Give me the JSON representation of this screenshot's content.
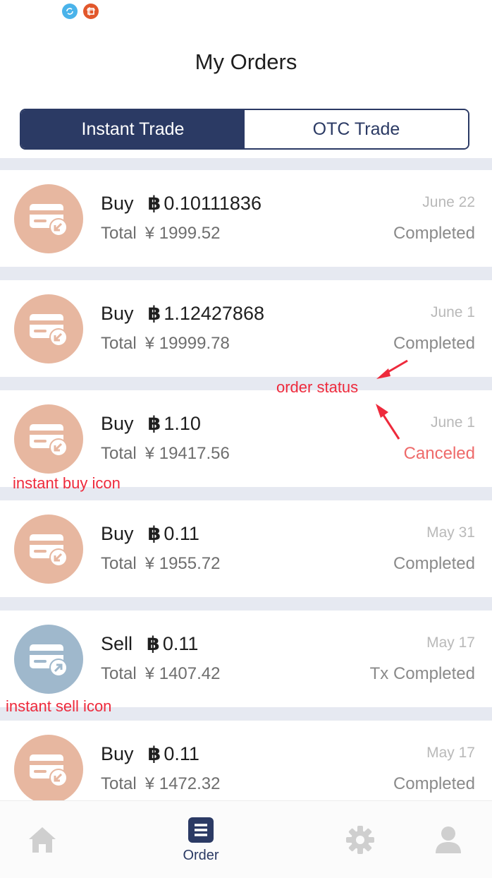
{
  "header": {
    "title": "My Orders"
  },
  "tabs": {
    "instant": "Instant Trade",
    "otc": "OTC Trade"
  },
  "currency": {
    "btc_symbol": "฿",
    "fiat_symbol": "¥"
  },
  "orders": [
    {
      "side": "Buy",
      "amount": "0.10111836",
      "total_label": "Total",
      "total": "1999.52",
      "date": "June 22",
      "status": "Completed",
      "icon": "instant-buy-icon"
    },
    {
      "side": "Buy",
      "amount": "1.12427868",
      "total_label": "Total",
      "total": "19999.78",
      "date": "June 1",
      "status": "Completed",
      "icon": "instant-buy-icon"
    },
    {
      "side": "Buy",
      "amount": "1.10",
      "total_label": "Total",
      "total": "19417.56",
      "date": "June 1",
      "status": "Canceled",
      "icon": "instant-buy-icon"
    },
    {
      "side": "Buy",
      "amount": "0.11",
      "total_label": "Total",
      "total": "1955.72",
      "date": "May 31",
      "status": "Completed",
      "icon": "instant-buy-icon"
    },
    {
      "side": "Sell",
      "amount": "0.11",
      "total_label": "Total",
      "total": "1407.42",
      "date": "May 17",
      "status": "Tx Completed",
      "icon": "instant-sell-icon"
    },
    {
      "side": "Buy",
      "amount": "0.11",
      "total_label": "Total",
      "total": "1472.32",
      "date": "May 17",
      "status": "Completed",
      "icon": "instant-buy-icon"
    }
  ],
  "annotations": {
    "order_status": "order status",
    "instant_buy_icon": "instant buy icon",
    "instant_sell_icon": "instant sell icon"
  },
  "tabbar": {
    "order_label": "Order",
    "icons": [
      "home-icon",
      "order-icon",
      "settings-icon",
      "profile-icon"
    ]
  },
  "colors": {
    "primary": "#2b3a64",
    "buy_icon_bg": "#e7b7a0",
    "sell_icon_bg": "#9fb8cc",
    "canceled": "#ee6a6a",
    "annotation": "#ee2a3c"
  }
}
